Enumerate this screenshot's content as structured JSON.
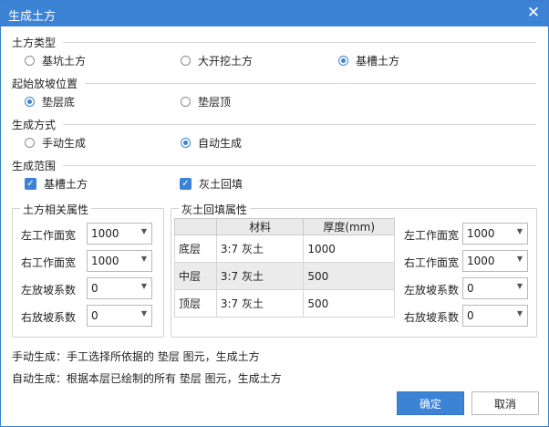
{
  "window": {
    "title": "生成土方",
    "close_icon": "✕"
  },
  "earthwork_type": {
    "label": "土方类型",
    "options": [
      "基坑土方",
      "大开挖土方",
      "基槽土方"
    ],
    "selected": "基槽土方"
  },
  "slope_start": {
    "label": "起始放坡位置",
    "options": [
      "垫层底",
      "垫层顶"
    ],
    "selected": "垫层底"
  },
  "generation_mode": {
    "label": "生成方式",
    "options": [
      "手动生成",
      "自动生成"
    ],
    "selected": "自动生成"
  },
  "generation_scope": {
    "label": "生成范围",
    "items": [
      {
        "label": "基槽土方",
        "checked": true
      },
      {
        "label": "灰土回填",
        "checked": true
      }
    ]
  },
  "earthwork_props": {
    "title": "土方相关属性",
    "rows": [
      {
        "label": "左工作面宽",
        "value": "1000"
      },
      {
        "label": "右工作面宽",
        "value": "1000"
      },
      {
        "label": "左放坡系数",
        "value": "0"
      },
      {
        "label": "右放坡系数",
        "value": "0"
      }
    ]
  },
  "backfill_props": {
    "title": "灰土回填属性",
    "table": {
      "headers": [
        "",
        "材料",
        "厚度(mm)"
      ],
      "rows": [
        {
          "layer": "底层",
          "material": "3:7 灰土",
          "thickness": "1000"
        },
        {
          "layer": "中层",
          "material": "3:7 灰土",
          "thickness": "500"
        },
        {
          "layer": "顶层",
          "material": "3:7 灰土",
          "thickness": "500"
        }
      ]
    },
    "rows": [
      {
        "label": "左工作面宽",
        "value": "1000"
      },
      {
        "label": "右工作面宽",
        "value": "1000"
      },
      {
        "label": "左放坡系数",
        "value": "0"
      },
      {
        "label": "右放坡系数",
        "value": "0"
      }
    ]
  },
  "notes": {
    "manual": "手动生成：手工选择所依据的 垫层 图元，生成土方",
    "auto": "自动生成：根据本层已绘制的所有 垫层 图元，生成土方"
  },
  "buttons": {
    "ok": "确定",
    "cancel": "取消"
  },
  "colors": {
    "accent": "#3c83d6"
  }
}
